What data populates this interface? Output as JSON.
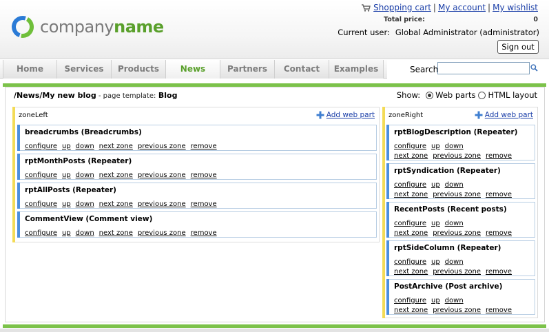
{
  "header": {
    "logo_word_light": "company",
    "logo_word_bold": "name",
    "links": {
      "shopping_cart": "Shopping cart",
      "my_account": "My account",
      "my_wishlist": "My wishlist",
      "separator": "|"
    },
    "total_price_label": "Total price:",
    "total_price_value": "0",
    "current_user_label": "Current user:",
    "current_user_value": "Global Administrator (administrator)",
    "sign_out": "Sign out"
  },
  "nav": {
    "items": [
      {
        "label": "Home"
      },
      {
        "label": "Services"
      },
      {
        "label": "Products"
      },
      {
        "label": "News",
        "active": true
      },
      {
        "label": "Partners"
      },
      {
        "label": "Contact"
      },
      {
        "label": "Examples"
      }
    ],
    "search_label": "Search:",
    "search_value": ""
  },
  "page": {
    "path": "/News/My new blog",
    "template_label": " - page template:",
    "template_name": "Blog",
    "show_label": "Show:",
    "options": {
      "web_parts": "Web parts",
      "html_layout": "HTML layout"
    },
    "selected_option": "web_parts"
  },
  "zones": {
    "left": {
      "name": "zoneLeft",
      "add_label": "Add web part",
      "webparts": [
        {
          "title": "breadcrumbs (Breadcrumbs)"
        },
        {
          "title": "rptMonthPosts (Repeater)"
        },
        {
          "title": "rptAllPosts (Repeater)"
        },
        {
          "title": "CommentView (Comment view)"
        }
      ]
    },
    "right": {
      "name": "zoneRight",
      "add_label": "Add web part",
      "webparts": [
        {
          "title": "rptBlogDescription (Repeater)"
        },
        {
          "title": "rptSyndication (Repeater)"
        },
        {
          "title": "RecentPosts (Recent posts)"
        },
        {
          "title": "rptSideColumn (Repeater)"
        },
        {
          "title": "PostArchive (Post archive)"
        }
      ]
    }
  },
  "actions": {
    "configure": "configure",
    "up": "up",
    "down": "down",
    "next_zone": "next zone",
    "previous_zone": "previous zone",
    "remove": "remove"
  },
  "colors": {
    "brand_green": "#5aa02c",
    "link_blue": "#1a3ea8",
    "zone_yellow": "#f3db57",
    "webpart_blue": "#4c8fde"
  }
}
